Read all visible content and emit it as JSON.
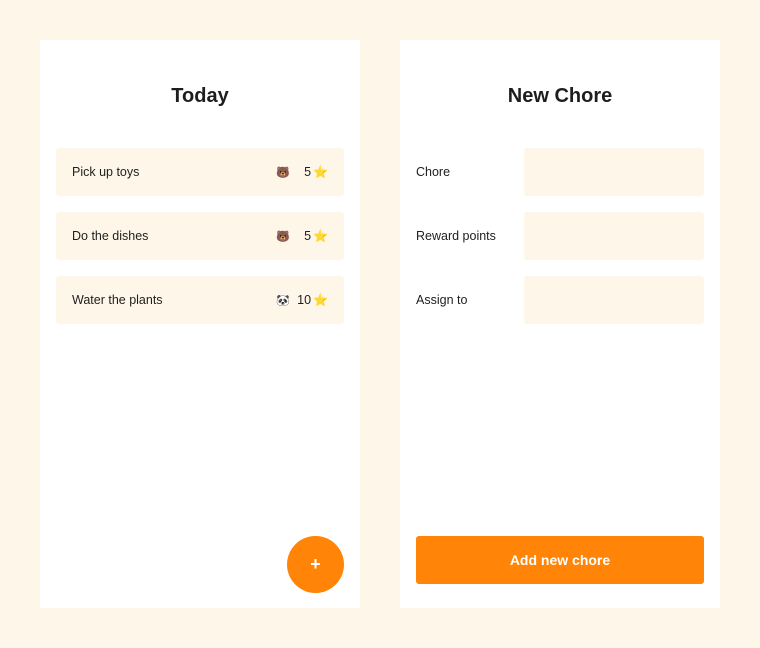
{
  "today": {
    "title": "Today",
    "chores": [
      {
        "name": "Pick up toys",
        "avatar": "🐻",
        "points": "5",
        "star": "⭐"
      },
      {
        "name": "Do the dishes",
        "avatar": "🐻",
        "points": "5",
        "star": "⭐"
      },
      {
        "name": "Water the plants",
        "avatar": "🐼",
        "points": "10",
        "star": "⭐"
      }
    ],
    "fab_label": "+"
  },
  "new_chore": {
    "title": "New Chore",
    "fields": [
      {
        "label": "Chore",
        "value": ""
      },
      {
        "label": "Reward points",
        "value": ""
      },
      {
        "label": "Assign to",
        "value": ""
      }
    ],
    "submit_label": "Add new chore"
  },
  "colors": {
    "background": "#fff6ea",
    "accent": "#ff8408",
    "panel": "#ffffff"
  }
}
